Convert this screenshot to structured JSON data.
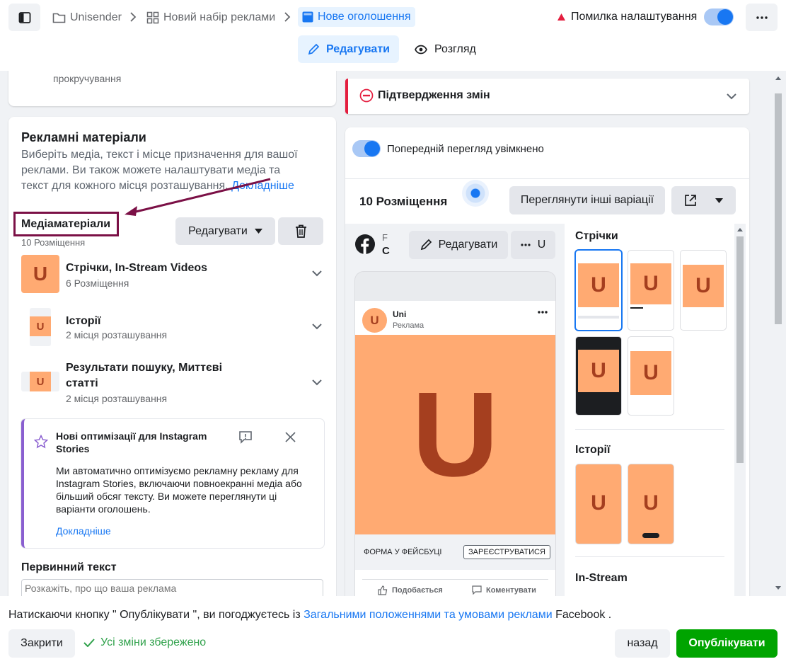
{
  "breadcrumb": {
    "items": [
      {
        "label": "Unisender"
      },
      {
        "label": "Новий набір реклами"
      },
      {
        "label": "Нове оголошення"
      }
    ]
  },
  "status": {
    "error_label": "Помилка налаштування"
  },
  "mode_tabs": {
    "edit": "Редагувати",
    "review": "Розгляд"
  },
  "left": {
    "top_card_text": "прокручування",
    "creative": {
      "title": "Рекламні матеріали",
      "description": "Виберіть медіа, текст і місце призначення для вашої реклами. Ви також можете налаштувати медіа та текст для кожного місця розташування.",
      "learn_more": "Докладніше",
      "media_label": "Медіаматеріали",
      "media_count": "10 Розміщення",
      "edit_button": "Редагувати",
      "groups": [
        {
          "title": "Стрічки, In-Stream Videos",
          "subtitle": "6 Розміщення"
        },
        {
          "title": "Історії",
          "subtitle": "2 місця розташування"
        },
        {
          "title": "Результати пошуку, Миттєві",
          "title2": "статті",
          "subtitle": "2 місця розташування"
        }
      ],
      "notice": {
        "title": "Нові оптимізації для Instagram",
        "title2": "Stories",
        "body": "Ми автоматично оптимізуємо рекламну рекламу для Instagram Stories, включаючи повноекранні медіа або більший обсяг тексту. Ви можете переглянути ці варіанти оголошень.",
        "link": "Докладніше"
      },
      "primary_text_label": "Первинний текст",
      "primary_text_placeholder": "Розкажіть, про що ваша реклама"
    }
  },
  "right": {
    "confirm_title": "Підтвердження змін",
    "preview_toggle_label": "Попередній перегляд увімкнено",
    "placements_title": "10 Розміщення",
    "other_variations": "Переглянути інші варіації",
    "page_initial": "F",
    "page_initial2": "C",
    "edit_label": "Редагувати",
    "more_label": "U",
    "post": {
      "page_name": "Uni",
      "sponsored": "Реклама",
      "logo_letter": "U",
      "form_label": "ФОРМА У ФЕЙСБУЦІ",
      "cta": "ЗАРЕЄСТРУВАТИСЯ",
      "like": "Подобається",
      "comment": "Коментувати"
    },
    "sections": {
      "feeds": "Стрічки",
      "stories": "Історії",
      "instream": "In-Stream"
    }
  },
  "footer": {
    "terms_prefix": "Натискаючи кнопку \" Опублікувати \", ви погоджуєтесь із",
    "terms_link": "Загальними положеннями та умовами реклами",
    "terms_suffix": "Facebook .",
    "close": "Закрити",
    "saved": "Усі зміни збережено",
    "back": "назад",
    "publish": "Опублікувати"
  },
  "colors": {
    "accent": "#1877f2",
    "publish": "#00a400",
    "error": "#e41e3f",
    "brand_orange": "#ffaa72",
    "brand_logo": "#a53f1f",
    "annotation": "#7b1046"
  }
}
